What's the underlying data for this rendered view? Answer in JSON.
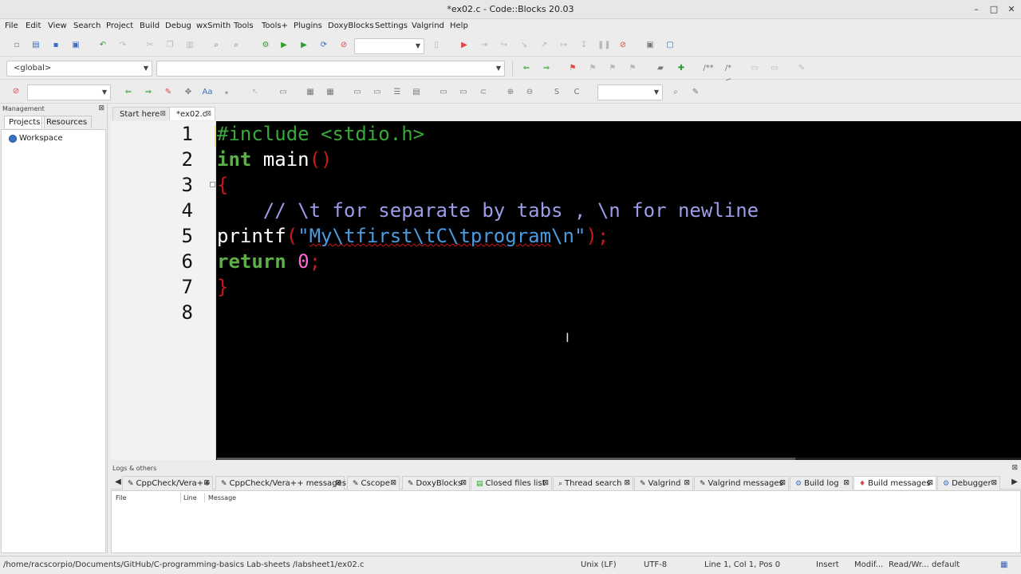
{
  "window": {
    "title": "*ex02.c - Code::Blocks 20.03",
    "minimize": "–",
    "maximize": "□",
    "close": "✕"
  },
  "menu": [
    "File",
    "Edit",
    "View",
    "Search",
    "Project",
    "Build",
    "Debug",
    "wxSmith",
    "Tools",
    "Tools+",
    "Plugins",
    "DoxyBlocks",
    "Settings",
    "Valgrind",
    "Help"
  ],
  "toolbar": {
    "scope_combo": "<global>",
    "function_combo": "",
    "build_target_combo": "",
    "search_combo": "",
    "zoom_combo": ""
  },
  "management": {
    "header": "Management",
    "tabs": [
      "Projects",
      "Resources"
    ],
    "active_tab": "Projects",
    "tree_root": "Workspace"
  },
  "editor_tabs": [
    {
      "label": "Start here",
      "active": false
    },
    {
      "label": "*ex02.c",
      "active": true
    }
  ],
  "editor": {
    "line_numbers": [
      "1",
      "2",
      "3",
      "4",
      "5",
      "6",
      "7",
      "8"
    ],
    "lines": [
      [
        {
          "t": "#include <stdio.h>",
          "c": "pp"
        }
      ],
      [
        {
          "t": "int",
          "c": "kw"
        },
        {
          "t": " main",
          "c": "tx"
        },
        {
          "t": "()",
          "c": "pn"
        }
      ],
      [
        {
          "t": "{",
          "c": "pn"
        }
      ],
      [
        {
          "t": "    // \\t for separate by tabs , \\n for newline",
          "c": "cm"
        }
      ],
      [
        {
          "t": "printf",
          "c": "tx"
        },
        {
          "t": "(",
          "c": "pn"
        },
        {
          "t": "\"",
          "c": "str"
        },
        {
          "t": "My\\tfirst\\tC\\tprogram",
          "c": "str sq"
        },
        {
          "t": "\\n\"",
          "c": "str"
        },
        {
          "t": ");",
          "c": "pn"
        }
      ],
      [
        {
          "t": "return",
          "c": "kw"
        },
        {
          "t": " ",
          "c": "tx"
        },
        {
          "t": "0",
          "c": "num"
        },
        {
          "t": ";",
          "c": "pn"
        }
      ],
      [
        {
          "t": "}",
          "c": "pn"
        }
      ],
      []
    ]
  },
  "logs": {
    "header": "Logs & others",
    "tabs": [
      {
        "label": "CppCheck/Vera++",
        "icon": "cppcheck-icon",
        "active": false
      },
      {
        "label": "CppCheck/Vera++ messages",
        "icon": "cppcheck-icon",
        "active": false
      },
      {
        "label": "Cscope",
        "icon": "cscope-icon",
        "active": false
      },
      {
        "label": "DoxyBlocks",
        "icon": "doxyblocks-icon",
        "active": false
      },
      {
        "label": "Closed files list",
        "icon": "closed-files-icon",
        "active": false
      },
      {
        "label": "Thread search",
        "icon": "thread-search-icon",
        "active": false
      },
      {
        "label": "Valgrind",
        "icon": "valgrind-icon",
        "active": false
      },
      {
        "label": "Valgrind messages",
        "icon": "valgrind-icon",
        "active": false
      },
      {
        "label": "Build log",
        "icon": "gear-icon",
        "active": false
      },
      {
        "label": "Build messages",
        "icon": "build-messages-icon",
        "active": true
      },
      {
        "label": "Debugger",
        "icon": "gear-icon",
        "active": false
      }
    ],
    "columns": [
      "File",
      "Line",
      "Message"
    ]
  },
  "status": {
    "path": "/home/racscorpio/Documents/GitHub/C-programming-basics Lab-sheets /labsheet1/ex02.c",
    "line_endings": "Unix (LF)",
    "encoding": "UTF-8",
    "position": "Line 1, Col 1, Pos 0",
    "mode": "Insert",
    "modified": "Modif...",
    "access": "Read/Wr...",
    "profile": "default"
  },
  "colors": {
    "editor_bg": "#000000",
    "preprocessor": "#39a839",
    "keyword": "#5db048",
    "punctuation": "#c61a1a",
    "comment": "#9c9ce8",
    "string": "#4a9be0",
    "number": "#ff66d8"
  }
}
